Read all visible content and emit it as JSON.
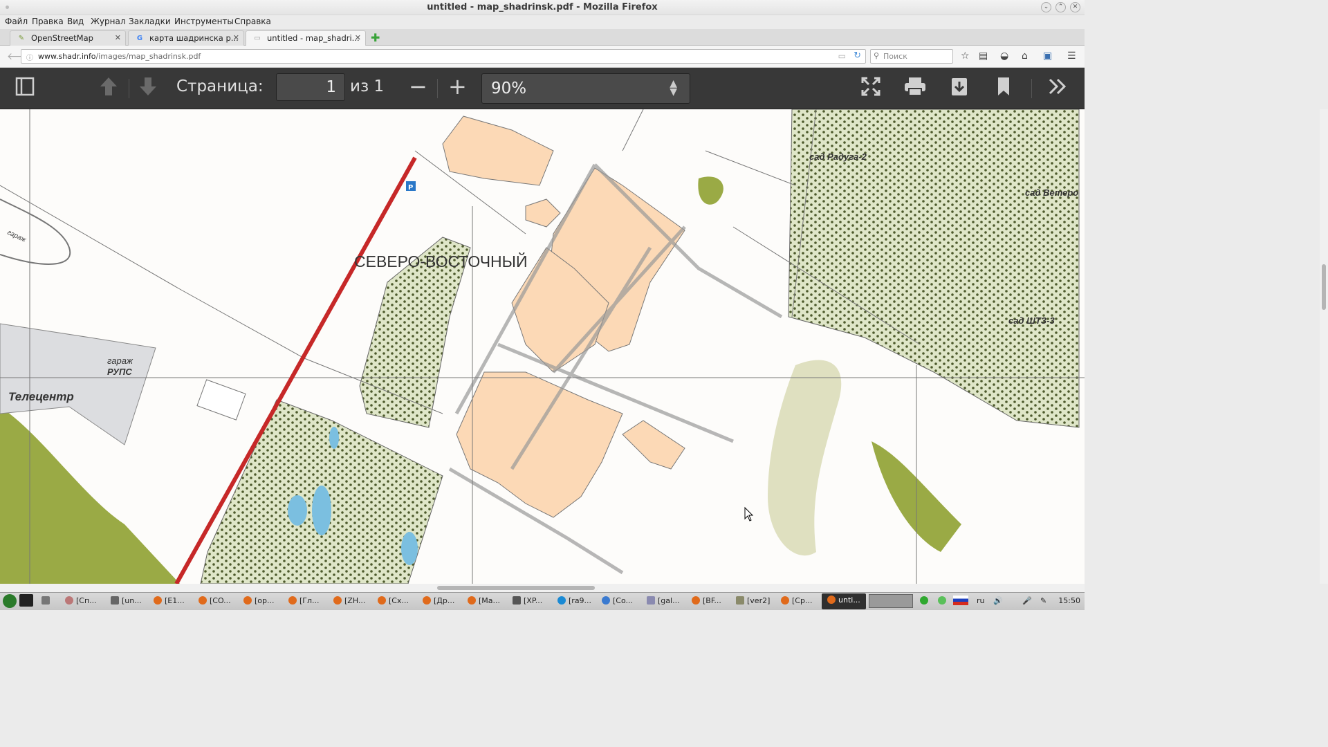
{
  "window": {
    "title": "untitled - map_shadrinsk.pdf - Mozilla Firefox"
  },
  "menu": [
    "Файл",
    "Правка",
    "Вид",
    "Журнал",
    "Закладки",
    "Инструменты",
    "Справка"
  ],
  "tabs": [
    {
      "label": "OpenStreetMap",
      "icon": "osm-icon"
    },
    {
      "label": "карта шадринска р...",
      "icon": "google-icon"
    },
    {
      "label": "untitled - map_shadri...",
      "icon": "pdf-icon"
    }
  ],
  "url": {
    "host": "www.shadr.info",
    "path": "/images/map_shadrinsk.pdf"
  },
  "search": {
    "placeholder": "Поиск"
  },
  "pdf": {
    "page_label": "Страница:",
    "page_value": "1",
    "of_pages": "из 1",
    "zoom": "90%"
  },
  "map": {
    "district": "СЕВЕРО-ВОСТОЧНЫЙ",
    "garden1": "сад Радуга-2",
    "garden2": "сад Ветеро",
    "garden3": "сад ШТЗ-3",
    "garage1": "гараж",
    "garage2": "РУПС",
    "telecentre": "Телецентр",
    "track_label": "гараж"
  },
  "taskbar": {
    "items": [
      "[Сп...",
      "[un...",
      "[E1...",
      "[CO...",
      "[op...",
      "[Гл...",
      "[ZH...",
      "[Сх...",
      "[Др...",
      "[Ма...",
      "[XP...",
      "[ra9...",
      "[Co...",
      "[gal...",
      "[BF...",
      "[ver2]",
      "[Ср..."
    ],
    "active": "unti...",
    "lang": "ru",
    "clock": "15:50"
  },
  "colors": {
    "toolbar": "#383838",
    "road": "#c62828",
    "garden": "#dfe6c8",
    "housing": "#fcd9b6",
    "forest": "#9aaa45"
  }
}
